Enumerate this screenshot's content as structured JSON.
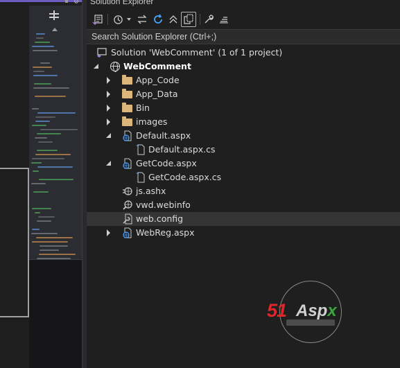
{
  "solution_explorer": {
    "title": "Solution Explorer",
    "search_placeholder": "Search Solution Explorer (Ctrl+;)",
    "tree": [
      {
        "label": "Solution 'WebComment' (1 of 1 project)",
        "icon": "solution-icon",
        "expander": "none"
      },
      {
        "label": "WebComment",
        "icon": "globe-icon",
        "expander": "expanded",
        "bold": true
      },
      {
        "label": "App_Code",
        "icon": "folder-icon",
        "expander": "collapsed"
      },
      {
        "label": "App_Data",
        "icon": "folder-icon",
        "expander": "collapsed"
      },
      {
        "label": "Bin",
        "icon": "folder-icon",
        "expander": "collapsed"
      },
      {
        "label": "images",
        "icon": "folder-icon",
        "expander": "collapsed"
      },
      {
        "label": "Default.aspx",
        "icon": "web-page-icon",
        "expander": "expanded"
      },
      {
        "label": "Default.aspx.cs",
        "icon": "cs-file-icon",
        "expander": "none"
      },
      {
        "label": "GetCode.aspx",
        "icon": "web-page-icon",
        "expander": "expanded"
      },
      {
        "label": "GetCode.aspx.cs",
        "icon": "cs-file-icon",
        "expander": "none"
      },
      {
        "label": "js.ashx",
        "icon": "handler-icon",
        "expander": "none"
      },
      {
        "label": "vwd.webinfo",
        "icon": "config-icon",
        "expander": "none"
      },
      {
        "label": "web.config",
        "icon": "config-icon",
        "expander": "none",
        "selected": true
      },
      {
        "label": "WebReg.aspx",
        "icon": "web-page-icon",
        "expander": "collapsed"
      }
    ]
  },
  "watermark": {
    "brand_red": "51",
    "brand_text": "Aspx",
    "brand_x": "X"
  },
  "colors": {
    "accent_purple": "#6a5fc1",
    "folder": "#dcb67a",
    "selection": "#353535",
    "brand_red": "#e0262b",
    "brand_green": "#3aa53c"
  }
}
